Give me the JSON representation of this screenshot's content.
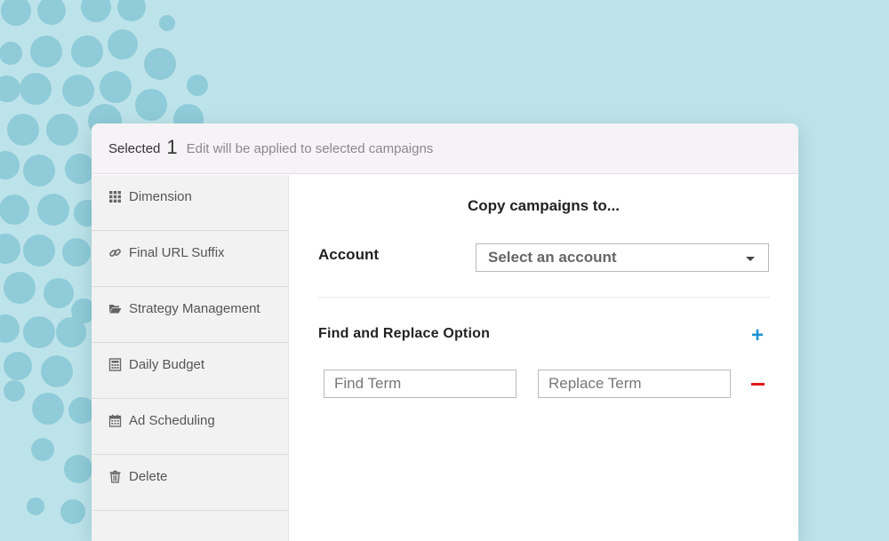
{
  "header": {
    "selected_label": "Selected",
    "selected_count": "1",
    "note": "Edit will be applied to selected campaigns"
  },
  "sidebar": {
    "items": [
      {
        "label": "Dimension",
        "icon": "grid-icon"
      },
      {
        "label": "Final URL Suffix",
        "icon": "link-icon"
      },
      {
        "label": "Strategy Management",
        "icon": "folder-open-icon"
      },
      {
        "label": "Daily Budget",
        "icon": "calculator-icon"
      },
      {
        "label": "Ad Scheduling",
        "icon": "calendar-icon"
      },
      {
        "label": "Delete",
        "icon": "trash-icon"
      }
    ]
  },
  "main": {
    "title": "Copy campaigns to...",
    "account_label": "Account",
    "account_select_value": "Select an account",
    "find_replace_label": "Find and Replace Option",
    "find_placeholder": "Find Term",
    "replace_placeholder": "Replace Term"
  },
  "colors": {
    "background": "#bde3ea",
    "dots": "#8fcbd8",
    "add_accent": "#2196d3",
    "remove_accent": "#e01a1a"
  }
}
